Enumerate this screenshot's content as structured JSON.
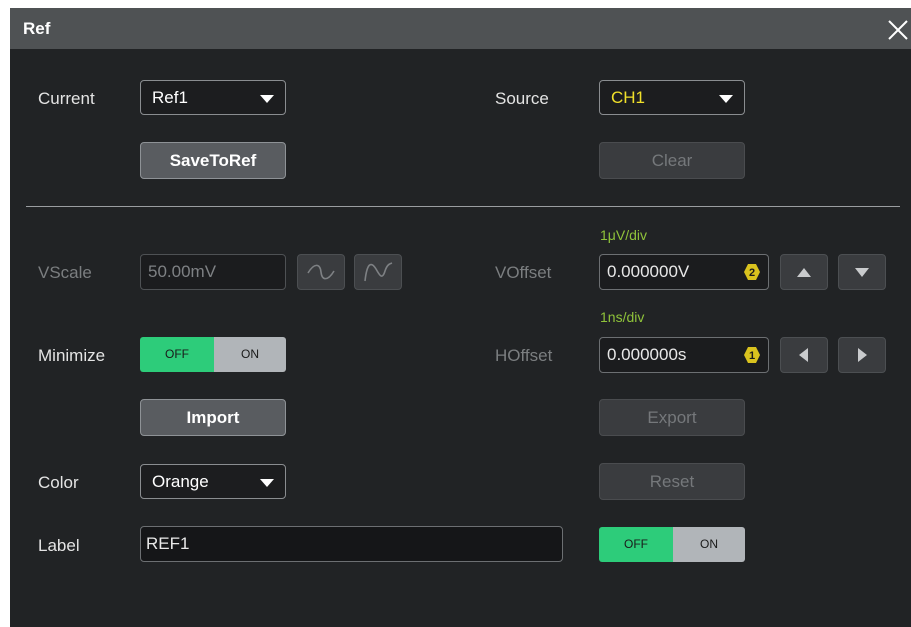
{
  "dialog": {
    "title": "Ref"
  },
  "current": {
    "label": "Current",
    "value": "Ref1"
  },
  "source": {
    "label": "Source",
    "value": "CH1",
    "value_color": "#f0e02a"
  },
  "buttons": {
    "save_to_ref": "SaveToRef",
    "clear": "Clear",
    "import": "Import",
    "export": "Export",
    "reset": "Reset"
  },
  "vscale": {
    "label": "VScale",
    "value": "50.00mV"
  },
  "voffset": {
    "label": "VOffset",
    "hint": "1μV/div",
    "value": "0.000000V",
    "knob": "2"
  },
  "minimize": {
    "label": "Minimize",
    "off": "OFF",
    "on": "ON",
    "state": "OFF"
  },
  "hoffset": {
    "label": "HOffset",
    "hint": "1ns/div",
    "value": "0.000000s",
    "knob": "1"
  },
  "color": {
    "label": "Color",
    "value": "Orange"
  },
  "label_row": {
    "label": "Label",
    "value": "REF1",
    "toggle_off": "OFF",
    "toggle_on": "ON",
    "state": "OFF"
  },
  "colors": {
    "accent_green": "#2dcc7a",
    "hint_green": "#8fc33a",
    "badge_yellow": "#d9c21e"
  }
}
